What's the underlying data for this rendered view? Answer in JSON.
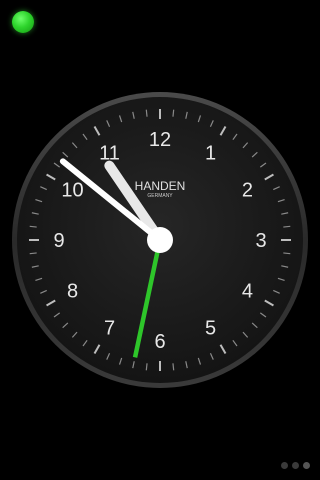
{
  "status_indicator": {
    "color": "#2ed42c"
  },
  "clock": {
    "brand": "HANDEN",
    "origin": "GERMANY",
    "numerals": [
      "12",
      "1",
      "2",
      "3",
      "4",
      "5",
      "6",
      "7",
      "8",
      "9",
      "10",
      "11"
    ],
    "time": {
      "hours": 10,
      "minutes": 51.5,
      "seconds": 32
    },
    "colors": {
      "face": "#1c1c1c",
      "rim": "#3a3a3a",
      "numerals": "#e8e8e8",
      "hands": "#ffffff",
      "second_hand": "#2ec62a"
    }
  },
  "pager": {
    "count": 3,
    "active_index": 2
  }
}
